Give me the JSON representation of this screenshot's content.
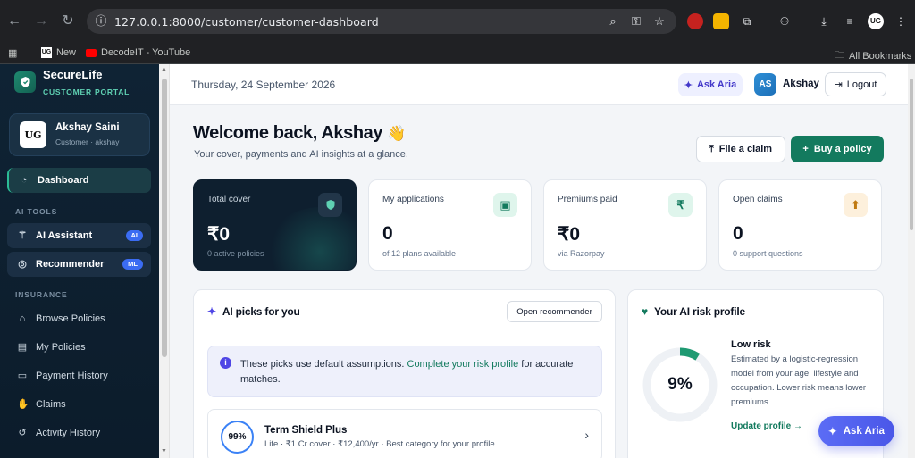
{
  "browser": {
    "url": "127.0.0.1:8000/customer/customer-dashboard",
    "bookmarks": [
      {
        "label": "New",
        "icon": "ug-favicon"
      },
      {
        "label": "DecodeIT - YouTube",
        "icon": "youtube-icon"
      }
    ],
    "all_bookmarks": "All Bookmarks",
    "profile_initials": "UG"
  },
  "sidebar": {
    "brand": "SecureLife",
    "brand_sub": "CUSTOMER PORTAL",
    "user": {
      "name": "Akshay Saini",
      "role": "Customer · akshay",
      "avatar": "UG"
    },
    "dashboard": "Dashboard",
    "ai_tools_label": "AI TOOLS",
    "ai_tools": [
      {
        "label": "AI Assistant",
        "badge": "AI"
      },
      {
        "label": "Recommender",
        "badge": "ML"
      }
    ],
    "insurance_label": "INSURANCE",
    "insurance": [
      {
        "label": "Browse Policies"
      },
      {
        "label": "My Policies"
      },
      {
        "label": "Payment History"
      },
      {
        "label": "Claims"
      },
      {
        "label": "Activity History"
      }
    ]
  },
  "topbar": {
    "date": "Thursday, 24 September 2026",
    "ask_aria": "Ask Aria",
    "avatar": "AS",
    "name": "Akshay",
    "logout": "Logout"
  },
  "welcome": {
    "title": "Welcome back, Akshay",
    "emoji": "👋",
    "subtitle": "Your cover, payments and AI insights at a glance.",
    "file_claim": "File a claim",
    "buy_policy": "Buy a policy"
  },
  "stats": [
    {
      "label": "Total cover",
      "value": "₹0",
      "foot": "0 active policies"
    },
    {
      "label": "My applications",
      "value": "0",
      "foot": "of 12 plans available"
    },
    {
      "label": "Premiums paid",
      "value": "₹0",
      "foot": "via Razorpay"
    },
    {
      "label": "Open claims",
      "value": "0",
      "foot": "0 support questions"
    }
  ],
  "picks": {
    "title": "AI picks for you",
    "open_recommender": "Open recommender",
    "info_prefix": "These picks use default assumptions.",
    "info_link": "Complete your risk profile",
    "info_suffix": "for accurate matches.",
    "items": [
      {
        "score": "99%",
        "name": "Term Shield Plus",
        "meta": "Life · ₹1 Cr cover · ₹12,400/yr · Best category for your profile"
      }
    ]
  },
  "risk": {
    "title": "Your AI risk profile",
    "value": "9%",
    "fraction": 0.09,
    "level": "Low risk",
    "description": "Estimated by a logistic-regression model from your age, lifestyle and occupation. Lower risk means lower premiums.",
    "link": "Update profile →"
  },
  "fab": {
    "label": "Ask Aria"
  },
  "colors": {
    "accent": "#137a5e",
    "sidebar": "#0f2334",
    "indigo": "#4f46e5"
  }
}
